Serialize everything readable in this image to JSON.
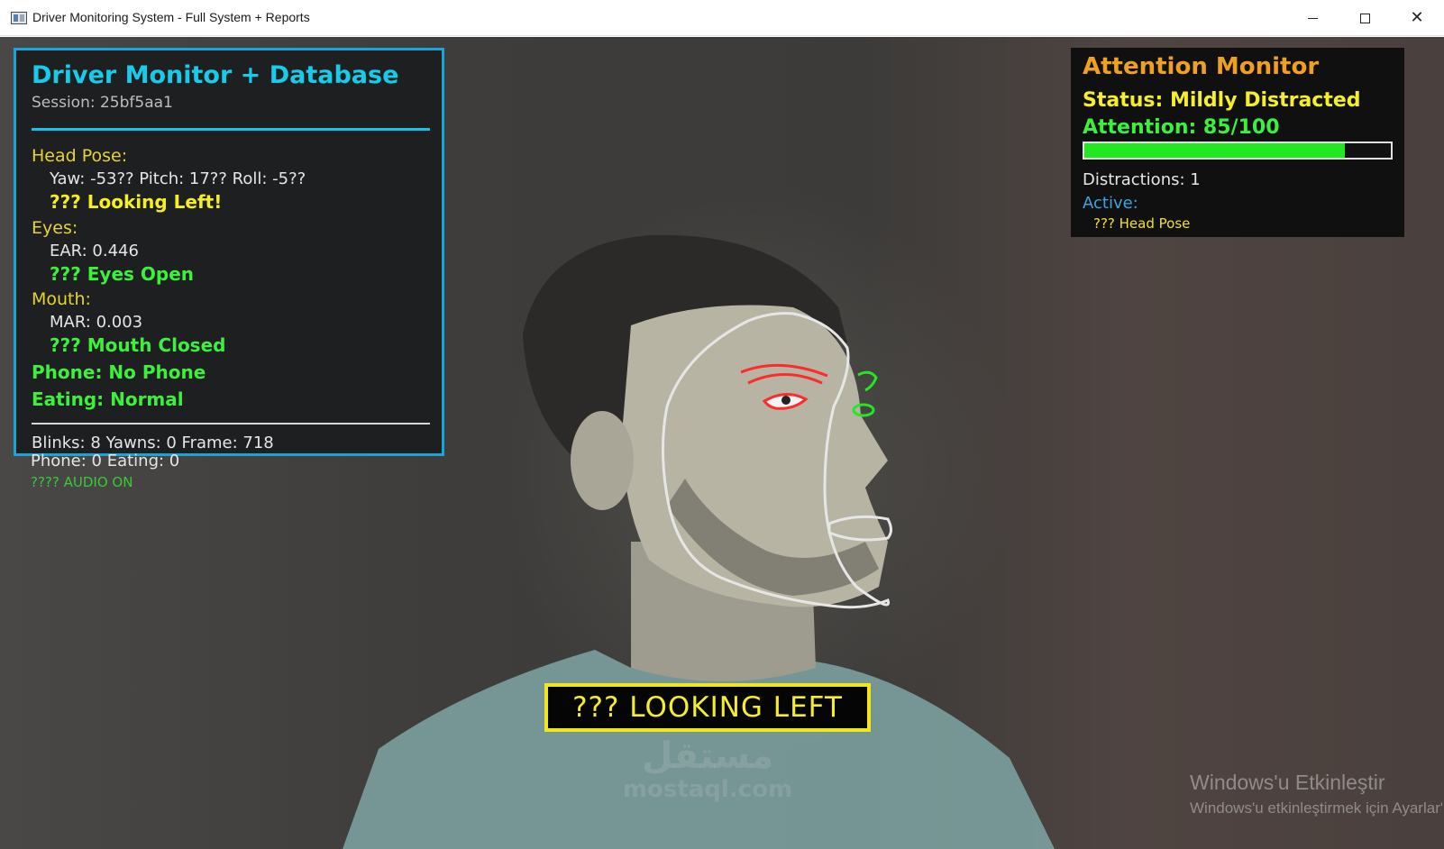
{
  "window": {
    "title": "Driver Monitoring System - Full System + Reports",
    "icons": [
      "app-window-icon",
      "minimize-icon",
      "maximize-icon",
      "close-icon"
    ]
  },
  "driver_panel": {
    "title": "Driver Monitor + Database",
    "session": "Session: 25bf5aa1",
    "head_pose_label": "Head Pose:",
    "head_pose_values": "Yaw: -53??   Pitch: 17??   Roll: -5??",
    "head_pose_status": "??? Looking Left!",
    "eyes_label": "Eyes:",
    "ear_value": "EAR: 0.446",
    "eyes_status": "??? Eyes Open",
    "mouth_label": "Mouth:",
    "mar_value": "MAR: 0.003",
    "mouth_status": "??? Mouth Closed",
    "phone_status": "Phone: No Phone",
    "eating_status": "Eating: Normal",
    "counters_line1": "Blinks: 8   Yawns: 0   Frame: 718",
    "counters_line2": "Phone: 0   Eating: 0",
    "audio_status": "???? AUDIO ON"
  },
  "attention_panel": {
    "title": "Attention Monitor",
    "status": "Status: Mildly Distracted",
    "score_text": "Attention: 85/100",
    "score": 85,
    "score_max": 100,
    "distractions": "Distractions: 1",
    "active_label": "Active:",
    "active_items": [
      "??? Head Pose"
    ]
  },
  "alert_banner": "??? LOOKING LEFT",
  "watermarks": {
    "activation_title": "Windows'u Etkinleştir",
    "activation_subtitle": "Windows'u etkinleştirmek için Ayarlar'a gidin.",
    "site_logo_arabic": "مستقل",
    "site_logo_latin": "mostaql.com"
  },
  "colors": {
    "panel_border": "#1aa5d8",
    "panel_title": "#17cbe9",
    "status_ok": "#3cf03c",
    "status_warn": "#f3ef25",
    "attention_title": "#f0a020",
    "alert_border": "#efe71c",
    "landmark_eye": "#ff2a2a",
    "landmark_far_eye": "#22e822",
    "landmark_outline": "#e6e6e6"
  }
}
